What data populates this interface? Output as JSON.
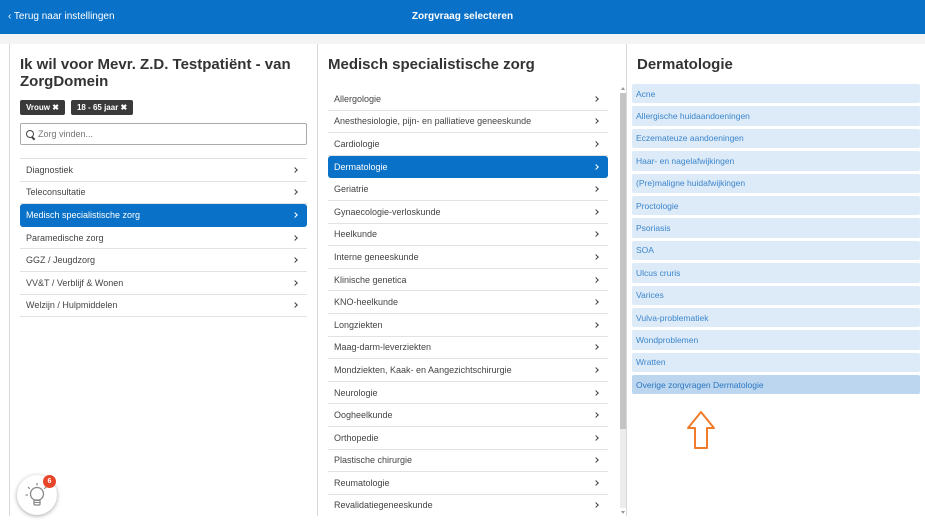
{
  "topbar": {
    "back_label": "‹ Terug naar instellingen",
    "title": "Zorgvraag selecteren"
  },
  "left": {
    "title": "Ik wil voor Mevr. Z.D. Testpatiënt - van ZorgDomein",
    "filters": [
      "Vrouw ✖",
      "18 - 65 jaar ✖"
    ],
    "search_placeholder": "Zorg vinden...",
    "items": [
      "Diagnostiek",
      "Teleconsultatie",
      "Medisch specialistische zorg",
      "Paramedische zorg",
      "GGZ / Jeugdzorg",
      "VV&T / Verblijf & Wonen",
      "Welzijn / Hulpmiddelen"
    ],
    "active_index": 2
  },
  "middle": {
    "title": "Medisch specialistische zorg",
    "items": [
      "Allergologie",
      "Anesthesiologie, pijn- en palliatieve geneeskunde",
      "Cardiologie",
      "Dermatologie",
      "Geriatrie",
      "Gynaecologie-verloskunde",
      "Heelkunde",
      "Interne geneeskunde",
      "Klinische genetica",
      "KNO-heelkunde",
      "Longziekten",
      "Maag-darm-leverziekten",
      "Mondziekten, Kaak- en Aangezichtschirurgie",
      "Neurologie",
      "Oogheelkunde",
      "Orthopedie",
      "Plastische chirurgie",
      "Reumatologie",
      "Revalidatiegeneeskunde"
    ],
    "active_index": 3
  },
  "right": {
    "title": "Dermatologie",
    "items": [
      "Acne",
      "Allergische huidaandoeningen",
      "Eczemateuze aandoeningen",
      "Haar- en nagelafwijkingen",
      "(Pre)maligne huidafwijkingen",
      "Proctologie",
      "Psoriasis",
      "SOA",
      "Ulcus cruris",
      "Varices",
      "Vulva-problematiek",
      "Wondproblemen",
      "Wratten",
      "Overige zorgvragen Dermatologie"
    ],
    "highlight_index": 13
  },
  "tips": {
    "badge_count": "6",
    "icon": "lightbulb-icon"
  },
  "colors": {
    "brand": "#0a71c8",
    "sub_item_bg": "#ddeaf7",
    "sub_item_text": "#3b86cc",
    "arrow": "#f07c2a",
    "badge": "#e8462a"
  }
}
